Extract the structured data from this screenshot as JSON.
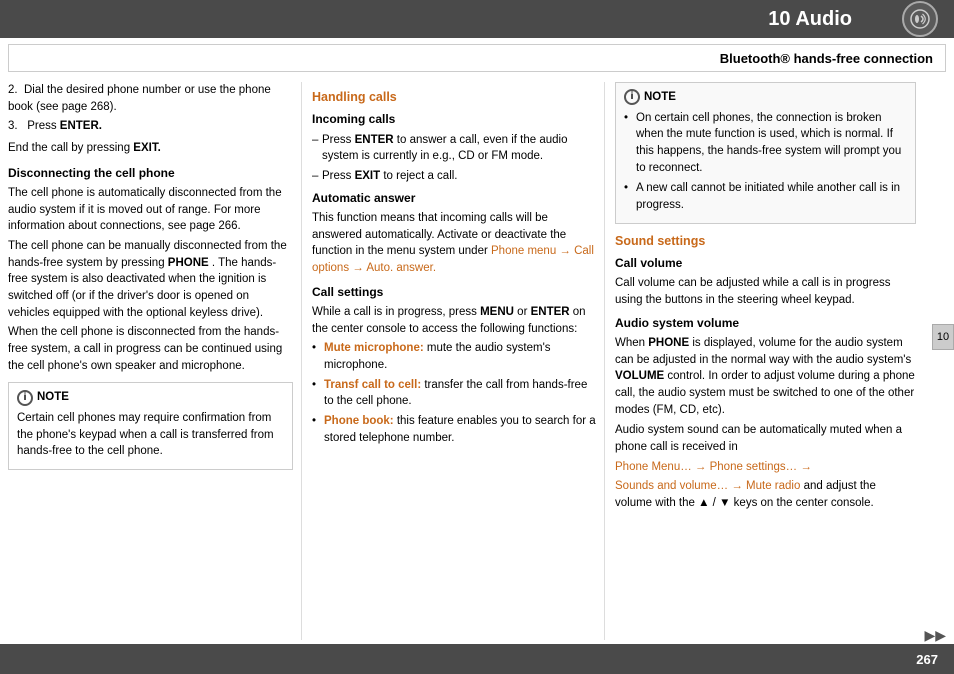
{
  "header": {
    "title": "10 Audio",
    "section_title": "Bluetooth® hands-free connection",
    "chapter_number": "10"
  },
  "left_column": {
    "step2": "Dial the desired phone number or use the phone book (see page 268).",
    "step3_prefix": "Press ",
    "step3_bold": "ENTER.",
    "end_call_prefix": "End the call by pressing ",
    "end_call_bold": "EXIT.",
    "disconnecting_heading": "Disconnecting the cell phone",
    "disconnecting_p1": "The cell phone is automatically disconnected from the audio system if it is moved out of range. For more information about connections, see page 266.",
    "disconnecting_p2_prefix": "The cell phone can be manually disconnected from the hands-free system by pressing ",
    "disconnecting_p2_bold": "PHONE",
    "disconnecting_p2_suffix": ". The hands-free system is also deactivated when the ignition is switched off (or if the driver's door is opened on vehicles equipped with the optional keyless drive).",
    "disconnecting_p3": "When the cell phone is disconnected from the hands-free system, a call in progress can be continued using the cell phone's own speaker and microphone.",
    "note_heading": "NOTE",
    "note_text": "Certain cell phones may require confirmation from the phone's keypad when a call is transferred from hands-free to the cell phone."
  },
  "middle_column": {
    "handling_heading": "Handling calls",
    "incoming_heading": "Incoming calls",
    "incoming_dash1_prefix": "Press ",
    "incoming_dash1_bold": "ENTER",
    "incoming_dash1_suffix": " to answer a call, even if the audio system is currently in e.g., CD or FM mode.",
    "incoming_dash2_prefix": "Press ",
    "incoming_dash2_bold": "EXIT",
    "incoming_dash2_suffix": " to reject a call.",
    "automatic_heading": "Automatic answer",
    "automatic_p": "This function means that incoming calls will be answered automatically. Activate or deactivate the function in the menu system under",
    "automatic_orange": "Phone menu → Call options → Auto. answer.",
    "call_settings_heading": "Call settings",
    "call_settings_p": "While a call is in progress, press ",
    "call_settings_bold1": "MENU",
    "call_settings_mid": " or ",
    "call_settings_bold2": "ENTER",
    "call_settings_suffix": " on the center console to access the following functions:",
    "bullet1_orange": "Mute microphone:",
    "bullet1_text": " mute the audio system's microphone.",
    "bullet2_orange": "Transf call to cell:",
    "bullet2_text": " transfer the call from hands-free to the cell phone.",
    "bullet3_orange": "Phone book:",
    "bullet3_text": " this feature enables you to search for a stored telephone number."
  },
  "right_column": {
    "note_heading": "NOTE",
    "note_bullet1": "On certain cell phones, the connection is broken when the mute function is used, which is normal. If this happens, the hands-free system will prompt you to reconnect.",
    "note_bullet2": "A new call cannot be initiated while another call is in progress.",
    "sound_heading": "Sound settings",
    "call_volume_heading": "Call volume",
    "call_volume_text": "Call volume can be adjusted while a call is in progress using the buttons in the steering wheel keypad.",
    "audio_system_heading": "Audio system volume",
    "audio_p1_prefix": "When ",
    "audio_p1_bold": "PHONE",
    "audio_p1_mid": " is displayed, volume for the audio system can be adjusted in the normal way with the audio system's ",
    "audio_p1_bold2": "VOLUME",
    "audio_p1_suffix": " control. In order to adjust volume during a phone call, the audio system must be switched to one of the other modes (FM, CD, etc).",
    "audio_p2": "Audio system sound can be automatically muted when a phone call is received in",
    "audio_orange1": "Phone Menu… → Phone settings… →",
    "audio_orange2": "Sounds and volume… → Mute radio",
    "audio_p3_prefix": " and adjust the volume with the ",
    "audio_p3_keys": "▲ / ▼",
    "audio_p3_suffix": " keys on the center console."
  },
  "footer": {
    "page_number": "267",
    "nav_arrow": "▶▶"
  }
}
